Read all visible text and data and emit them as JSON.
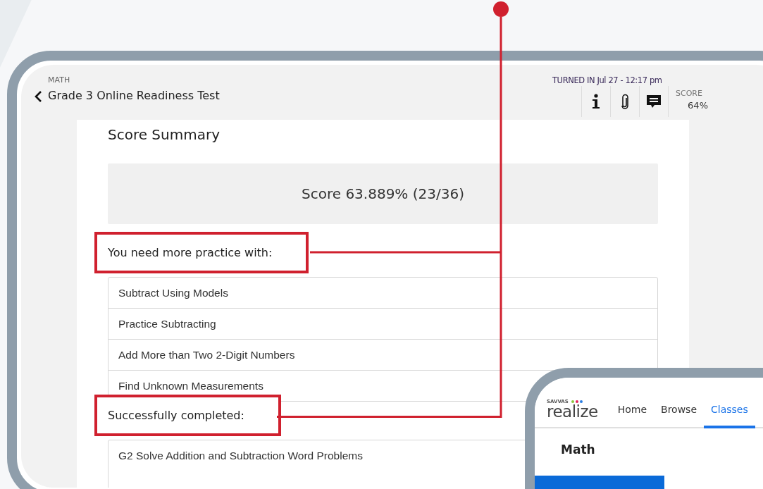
{
  "assignment_window": {
    "subject": "MATH",
    "title": "Grade 3 Online Readiness Test",
    "turned_in": "TURNED IN Jul 27 - 12:17 pm",
    "score_label": "SCORE",
    "score_value": "64%",
    "summary": {
      "heading": "Score Summary",
      "score": "Score 63.889% (23/36)",
      "sections": [
        {
          "heading": "You need more practice with:",
          "highlighted": true,
          "items": [
            "Subtract Using Models",
            "Practice Subtracting",
            "Add More than Two 2-Digit Numbers",
            "Find Unknown Measurements"
          ]
        },
        {
          "heading": "Successfully completed:",
          "highlighted": true,
          "items": [
            "G2 Solve Addition and Subtraction Word Problems"
          ]
        }
      ]
    }
  },
  "realize_window": {
    "logo": {
      "brand": "SAVVAS",
      "name": "realize"
    },
    "nav": [
      {
        "label": "Home",
        "selected": false
      },
      {
        "label": "Browse",
        "selected": false
      },
      {
        "label": "Classes",
        "selected": true
      }
    ],
    "heading": "Math"
  }
}
